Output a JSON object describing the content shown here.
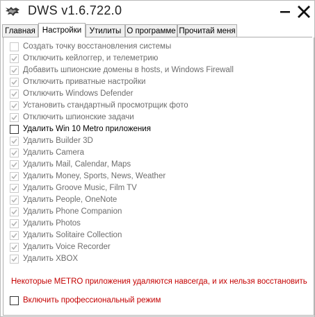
{
  "window": {
    "title": "DWS v1.6.722.0",
    "icon": "wolf-logo-icon",
    "controls": [
      "minimize",
      "close"
    ]
  },
  "tabs": [
    {
      "label": "Главная",
      "active": false
    },
    {
      "label": "Настройки",
      "active": true
    },
    {
      "label": "Утилиты",
      "active": false
    },
    {
      "label": "О программе",
      "active": false
    },
    {
      "label": "Прочитай меня",
      "active": false
    }
  ],
  "options": [
    {
      "label": "Создать точку восстановления системы",
      "checked": false,
      "enabled": false
    },
    {
      "label": "Отключить кейлоггер, и телеметрию",
      "checked": true,
      "enabled": false
    },
    {
      "label": "Добавить шпионские домены в hosts, и Windows Firewall",
      "checked": true,
      "enabled": false
    },
    {
      "label": "Отключить приватные настройки",
      "checked": true,
      "enabled": false
    },
    {
      "label": "Отключить Windows Defender",
      "checked": true,
      "enabled": false
    },
    {
      "label": "Установить стандартный просмотрщик фото",
      "checked": true,
      "enabled": false
    },
    {
      "label": "Отключить шпионские задачи",
      "checked": true,
      "enabled": false
    },
    {
      "label": "Удалить Win 10 Metro приложения",
      "checked": false,
      "enabled": true
    },
    {
      "label": "Удалить Builder 3D",
      "checked": true,
      "enabled": false
    },
    {
      "label": "Удалить Camera",
      "checked": true,
      "enabled": false
    },
    {
      "label": "Удалить Mail, Calendar, Maps",
      "checked": true,
      "enabled": false
    },
    {
      "label": "Удалить Money, Sports, News, Weather",
      "checked": true,
      "enabled": false
    },
    {
      "label": "Удалить Groove Music, Film TV",
      "checked": true,
      "enabled": false
    },
    {
      "label": "Удалить People, OneNote",
      "checked": true,
      "enabled": false
    },
    {
      "label": "Удалить Phone Companion",
      "checked": true,
      "enabled": false
    },
    {
      "label": "Удалить Photos",
      "checked": true,
      "enabled": false
    },
    {
      "label": "Удалить Solitaire Collection",
      "checked": true,
      "enabled": false
    },
    {
      "label": "Удалить Voice Recorder",
      "checked": true,
      "enabled": false
    },
    {
      "label": "Удалить XBOX",
      "checked": true,
      "enabled": false
    }
  ],
  "warning": "Некоторые METRO приложения удаляются навсегда, и их нельзя восстановить",
  "pro_mode": {
    "label": "Включить профессиональный режим",
    "checked": false
  },
  "colors": {
    "warning_text": "#c40000",
    "disabled_text": "#6d6d6d",
    "check_disabled": "#b4b4b4"
  }
}
